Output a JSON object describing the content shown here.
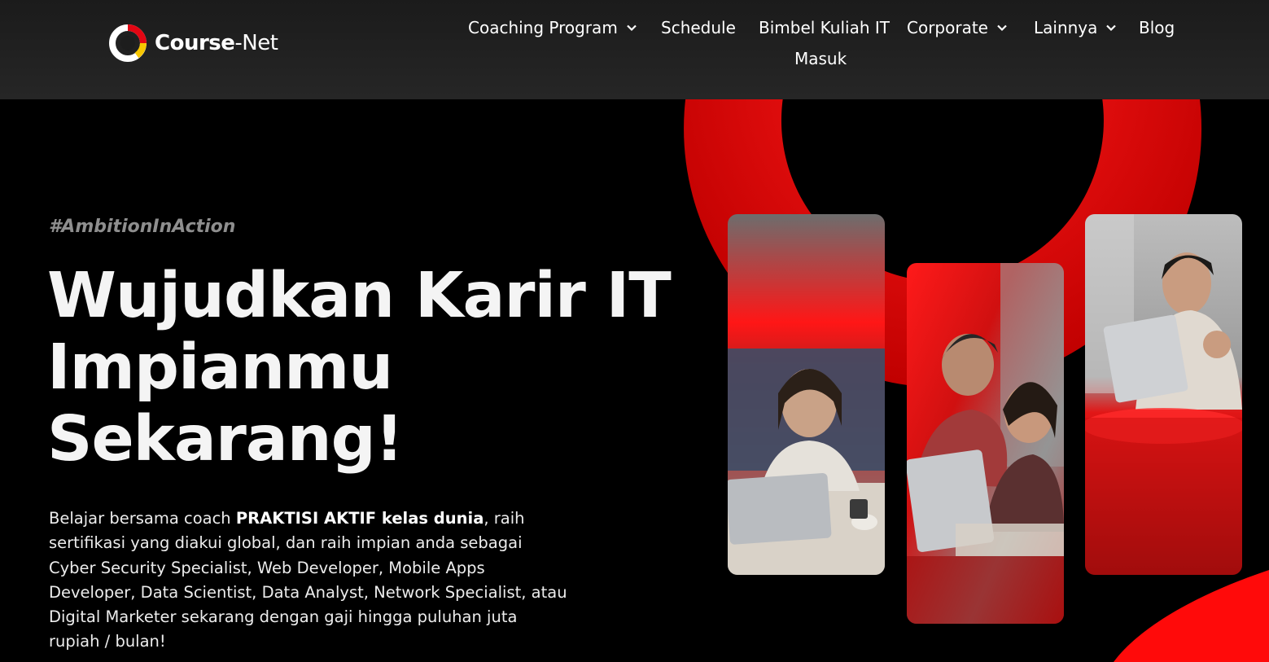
{
  "brand": {
    "name_strong": "Course",
    "name_light": "-Net",
    "logo_icon": "course-net-ring-logo",
    "colors": {
      "red": "#e30613",
      "yellow": "#f7c600",
      "white": "#ffffff"
    }
  },
  "nav": {
    "coaching": "Coaching Program",
    "schedule": "Schedule",
    "bimbel": "Bimbel Kuliah IT",
    "corporate": "Corporate",
    "lainnya": "Lainnya",
    "blog": "Blog",
    "masuk": "Masuk",
    "dropdown_icon": "chevron-down-icon"
  },
  "hero": {
    "hashtag": "#AmbitionInAction",
    "title_line1": "Wujudkan Karir IT",
    "title_line2": "Impianmu",
    "title_line3": "Sekarang!",
    "desc_start": "Belajar bersama coach ",
    "desc_bold": "PRAKTISI AKTIF kelas dunia",
    "desc_rest": ", raih sertifikasi yang diakui global, dan raih impian anda sebagai Cyber Security Specialist, Web Developer, Mobile Apps Developer, Data Scientist, Data Analyst, Network Specialist, atau Digital Marketer sekarang dengan gaji hingga puluhan juta rupiah / bulan!"
  },
  "photos": [
    {
      "subject": "woman-smiling-with-laptop"
    },
    {
      "subject": "two-students-at-laptop"
    },
    {
      "subject": "man-celebrating-at-laptop"
    }
  ],
  "accent_color": "#ff0000"
}
